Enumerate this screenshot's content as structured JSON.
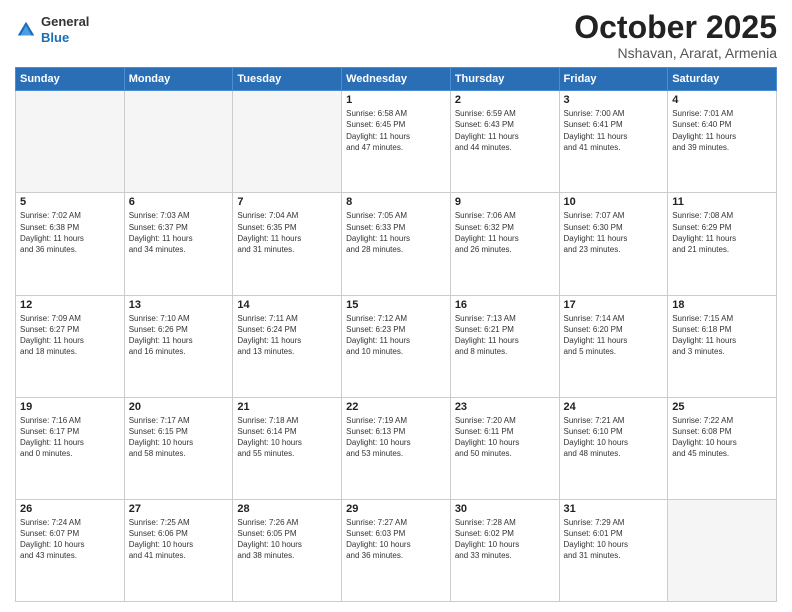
{
  "header": {
    "logo_general": "General",
    "logo_blue": "Blue",
    "month_title": "October 2025",
    "subtitle": "Nshavan, Ararat, Armenia"
  },
  "days_of_week": [
    "Sunday",
    "Monday",
    "Tuesday",
    "Wednesday",
    "Thursday",
    "Friday",
    "Saturday"
  ],
  "weeks": [
    [
      {
        "day": "",
        "info": ""
      },
      {
        "day": "",
        "info": ""
      },
      {
        "day": "",
        "info": ""
      },
      {
        "day": "1",
        "info": "Sunrise: 6:58 AM\nSunset: 6:45 PM\nDaylight: 11 hours\nand 47 minutes."
      },
      {
        "day": "2",
        "info": "Sunrise: 6:59 AM\nSunset: 6:43 PM\nDaylight: 11 hours\nand 44 minutes."
      },
      {
        "day": "3",
        "info": "Sunrise: 7:00 AM\nSunset: 6:41 PM\nDaylight: 11 hours\nand 41 minutes."
      },
      {
        "day": "4",
        "info": "Sunrise: 7:01 AM\nSunset: 6:40 PM\nDaylight: 11 hours\nand 39 minutes."
      }
    ],
    [
      {
        "day": "5",
        "info": "Sunrise: 7:02 AM\nSunset: 6:38 PM\nDaylight: 11 hours\nand 36 minutes."
      },
      {
        "day": "6",
        "info": "Sunrise: 7:03 AM\nSunset: 6:37 PM\nDaylight: 11 hours\nand 34 minutes."
      },
      {
        "day": "7",
        "info": "Sunrise: 7:04 AM\nSunset: 6:35 PM\nDaylight: 11 hours\nand 31 minutes."
      },
      {
        "day": "8",
        "info": "Sunrise: 7:05 AM\nSunset: 6:33 PM\nDaylight: 11 hours\nand 28 minutes."
      },
      {
        "day": "9",
        "info": "Sunrise: 7:06 AM\nSunset: 6:32 PM\nDaylight: 11 hours\nand 26 minutes."
      },
      {
        "day": "10",
        "info": "Sunrise: 7:07 AM\nSunset: 6:30 PM\nDaylight: 11 hours\nand 23 minutes."
      },
      {
        "day": "11",
        "info": "Sunrise: 7:08 AM\nSunset: 6:29 PM\nDaylight: 11 hours\nand 21 minutes."
      }
    ],
    [
      {
        "day": "12",
        "info": "Sunrise: 7:09 AM\nSunset: 6:27 PM\nDaylight: 11 hours\nand 18 minutes."
      },
      {
        "day": "13",
        "info": "Sunrise: 7:10 AM\nSunset: 6:26 PM\nDaylight: 11 hours\nand 16 minutes."
      },
      {
        "day": "14",
        "info": "Sunrise: 7:11 AM\nSunset: 6:24 PM\nDaylight: 11 hours\nand 13 minutes."
      },
      {
        "day": "15",
        "info": "Sunrise: 7:12 AM\nSunset: 6:23 PM\nDaylight: 11 hours\nand 10 minutes."
      },
      {
        "day": "16",
        "info": "Sunrise: 7:13 AM\nSunset: 6:21 PM\nDaylight: 11 hours\nand 8 minutes."
      },
      {
        "day": "17",
        "info": "Sunrise: 7:14 AM\nSunset: 6:20 PM\nDaylight: 11 hours\nand 5 minutes."
      },
      {
        "day": "18",
        "info": "Sunrise: 7:15 AM\nSunset: 6:18 PM\nDaylight: 11 hours\nand 3 minutes."
      }
    ],
    [
      {
        "day": "19",
        "info": "Sunrise: 7:16 AM\nSunset: 6:17 PM\nDaylight: 11 hours\nand 0 minutes."
      },
      {
        "day": "20",
        "info": "Sunrise: 7:17 AM\nSunset: 6:15 PM\nDaylight: 10 hours\nand 58 minutes."
      },
      {
        "day": "21",
        "info": "Sunrise: 7:18 AM\nSunset: 6:14 PM\nDaylight: 10 hours\nand 55 minutes."
      },
      {
        "day": "22",
        "info": "Sunrise: 7:19 AM\nSunset: 6:13 PM\nDaylight: 10 hours\nand 53 minutes."
      },
      {
        "day": "23",
        "info": "Sunrise: 7:20 AM\nSunset: 6:11 PM\nDaylight: 10 hours\nand 50 minutes."
      },
      {
        "day": "24",
        "info": "Sunrise: 7:21 AM\nSunset: 6:10 PM\nDaylight: 10 hours\nand 48 minutes."
      },
      {
        "day": "25",
        "info": "Sunrise: 7:22 AM\nSunset: 6:08 PM\nDaylight: 10 hours\nand 45 minutes."
      }
    ],
    [
      {
        "day": "26",
        "info": "Sunrise: 7:24 AM\nSunset: 6:07 PM\nDaylight: 10 hours\nand 43 minutes."
      },
      {
        "day": "27",
        "info": "Sunrise: 7:25 AM\nSunset: 6:06 PM\nDaylight: 10 hours\nand 41 minutes."
      },
      {
        "day": "28",
        "info": "Sunrise: 7:26 AM\nSunset: 6:05 PM\nDaylight: 10 hours\nand 38 minutes."
      },
      {
        "day": "29",
        "info": "Sunrise: 7:27 AM\nSunset: 6:03 PM\nDaylight: 10 hours\nand 36 minutes."
      },
      {
        "day": "30",
        "info": "Sunrise: 7:28 AM\nSunset: 6:02 PM\nDaylight: 10 hours\nand 33 minutes."
      },
      {
        "day": "31",
        "info": "Sunrise: 7:29 AM\nSunset: 6:01 PM\nDaylight: 10 hours\nand 31 minutes."
      },
      {
        "day": "",
        "info": ""
      }
    ]
  ]
}
